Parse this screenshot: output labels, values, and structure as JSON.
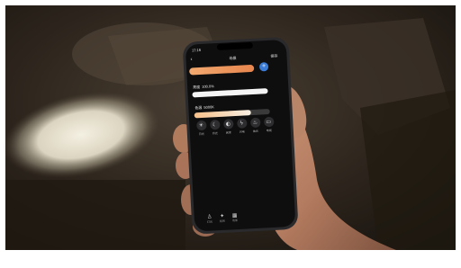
{
  "phone": {
    "status_time": "17:16",
    "nav_title": "场景",
    "nav_action": "保存",
    "brightness_label": "亮度",
    "brightness_value": "100.0%",
    "brightness_level": 1.0,
    "colortemp_label": "色温",
    "colortemp_value": "5000K",
    "colortemp_level": 0.75,
    "color_bar": "#e8935a",
    "accent": "#3a7bd5",
    "effects": [
      {
        "icon": "sun-icon",
        "label": "日光"
      },
      {
        "icon": "moon-icon",
        "label": "月光"
      },
      {
        "icon": "lamp-icon",
        "label": "阅读"
      },
      {
        "icon": "bolt-icon",
        "label": "闪电"
      },
      {
        "icon": "fire-icon",
        "label": "烛光"
      },
      {
        "icon": "tv-icon",
        "label": "电视"
      }
    ],
    "tabbar": [
      {
        "icon": "light-icon",
        "label": "灯光"
      },
      {
        "icon": "effect-icon",
        "label": "特效"
      },
      {
        "icon": "scene-icon",
        "label": "场景"
      }
    ]
  }
}
